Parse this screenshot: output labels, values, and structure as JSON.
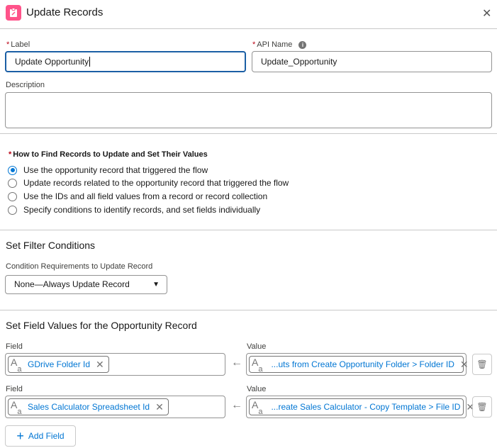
{
  "header": {
    "title": "Update Records",
    "close_icon": "close-icon",
    "brand_color": "#ff538a"
  },
  "label": {
    "label": "Label",
    "value": "Update Opportunity"
  },
  "api_name": {
    "label": "API Name",
    "value": "Update_Opportunity"
  },
  "description": {
    "label": "Description",
    "value": ""
  },
  "how_to_find": {
    "label": "How to Find Records to Update and Set Their Values",
    "options": [
      {
        "label": "Use the opportunity record that triggered the flow",
        "selected": true
      },
      {
        "label": "Update records related to the opportunity record that triggered the flow",
        "selected": false
      },
      {
        "label": "Use the IDs and all field values from a record or record collection",
        "selected": false
      },
      {
        "label": "Specify conditions to identify records, and set fields individually",
        "selected": false
      }
    ]
  },
  "filter": {
    "heading": "Set Filter Conditions",
    "label": "Condition Requirements to Update Record",
    "value": "None—Always Update Record"
  },
  "fields": {
    "heading": "Set Field Values for the Opportunity Record",
    "field_label": "Field",
    "value_label": "Value",
    "rows": [
      {
        "field": "GDrive Folder Id",
        "value": "...uts from Create Opportunity Folder > Folder ID"
      },
      {
        "field": "Sales Calculator Spreadsheet Id",
        "value": "...reate Sales Calculator - Copy Template > File ID"
      }
    ],
    "add_label": "Add Field"
  }
}
